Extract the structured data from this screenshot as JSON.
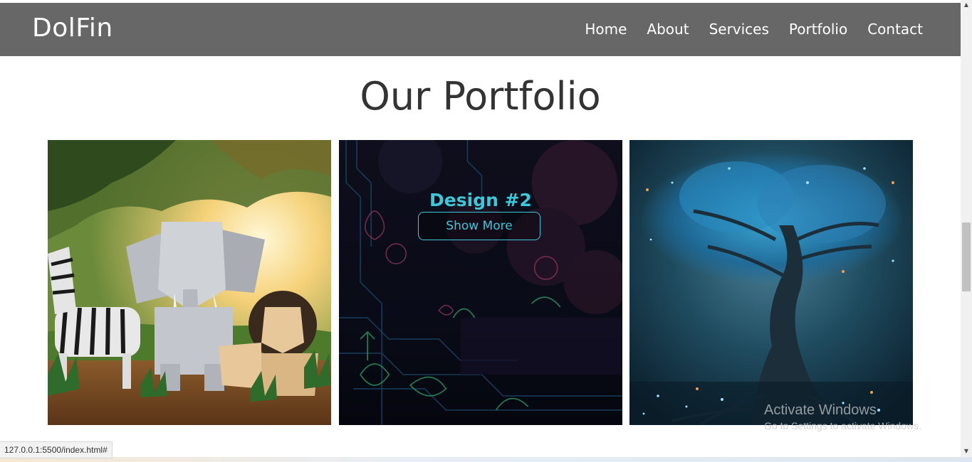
{
  "nav": {
    "brand": "DolFin",
    "links": [
      "Home",
      "About",
      "Services",
      "Portfolio",
      "Contact"
    ]
  },
  "portfolio": {
    "title": "Our Portfolio",
    "items": [
      {
        "image": "origami-animals-savanna"
      },
      {
        "image": "neon-circuit-forest",
        "overlay_title": "Design #2",
        "overlay_button": "Show More"
      },
      {
        "image": "glowing-blue-tree"
      }
    ]
  },
  "status_bar": {
    "url": "127.0.0.1:5500/index.html#"
  },
  "watermark": {
    "title": "Activate Windows",
    "subtitle": "Go to Settings to activate Windows."
  },
  "colors": {
    "navbar_bg": "#676767",
    "accent": "#3ec6d9",
    "title_text": "#333333"
  }
}
